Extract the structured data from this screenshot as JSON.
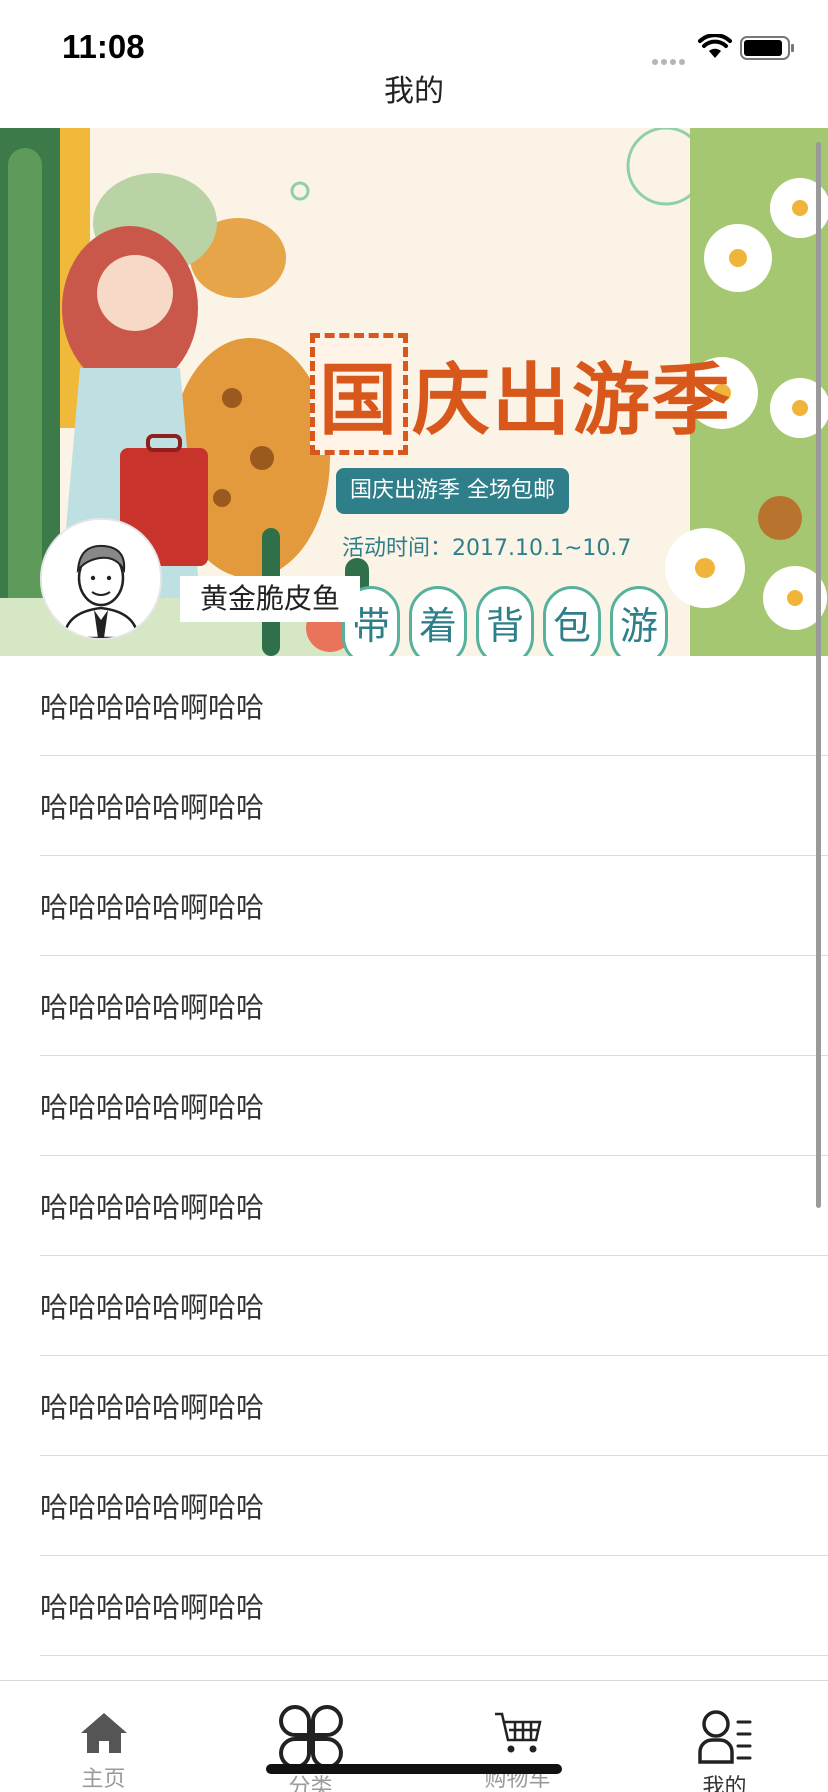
{
  "status_bar": {
    "time": "11:08"
  },
  "nav": {
    "title": "我的"
  },
  "banner": {
    "title_first_char": "国",
    "title_rest": "庆出游季",
    "subtitle": "国庆出游季 全场包邮",
    "date": "活动时间：2017.10.1~10.7",
    "circle_chars": [
      "带",
      "着",
      "背",
      "包",
      "游"
    ]
  },
  "profile": {
    "username": "黄金脆皮鱼"
  },
  "list_items": [
    "哈哈哈哈哈啊哈哈",
    "哈哈哈哈哈啊哈哈",
    "哈哈哈哈哈啊哈哈",
    "哈哈哈哈哈啊哈哈",
    "哈哈哈哈哈啊哈哈",
    "哈哈哈哈哈啊哈哈",
    "哈哈哈哈哈啊哈哈",
    "哈哈哈哈哈啊哈哈",
    "哈哈哈哈哈啊哈哈",
    "哈哈哈哈哈啊哈哈"
  ],
  "tabbar": {
    "tabs": [
      {
        "label": "主页",
        "icon": "home-icon"
      },
      {
        "label": "分类",
        "icon": "category-icon"
      },
      {
        "label": "购物车",
        "icon": "cart-icon"
      },
      {
        "label": "我的",
        "icon": "profile-icon",
        "active": true
      }
    ]
  },
  "colors": {
    "banner_title": "#d8581c",
    "banner_accent": "#2f7f8a",
    "divider": "#dcdcdc",
    "tab_inactive": "#9a9a9a",
    "tab_active": "#333333"
  }
}
